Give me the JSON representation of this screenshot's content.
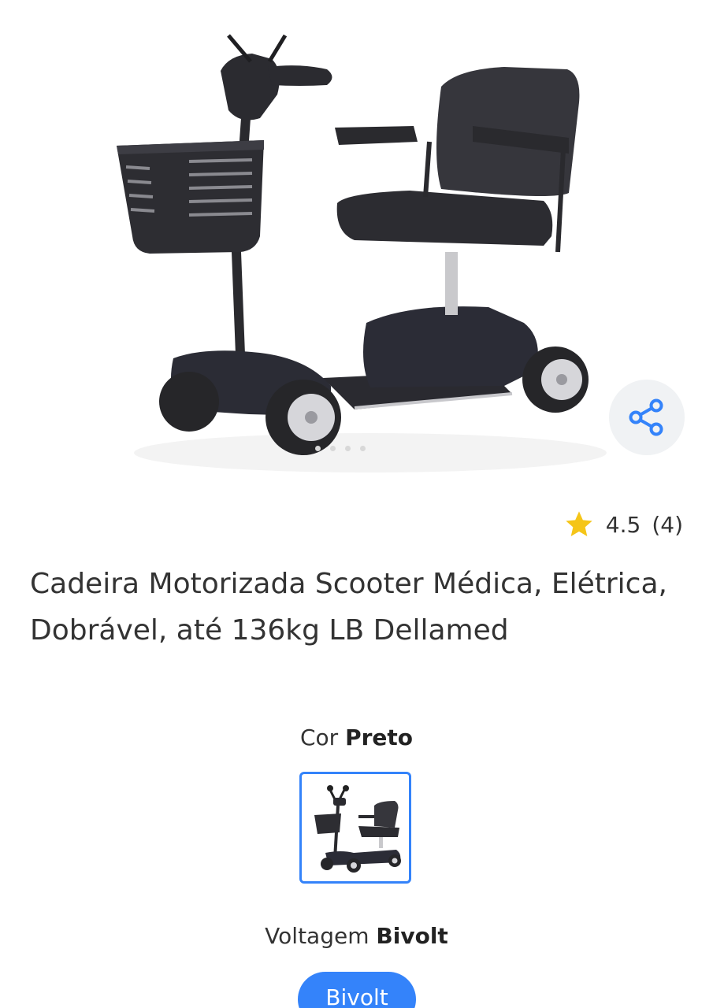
{
  "product": {
    "image_alt": "Scooter motorizada preta com cesto",
    "rating_value": "4.5",
    "rating_count": "(4)",
    "title": "Cadeira Motorizada Scooter Médica, Elétrica, Dobrável, até 136kg LB Dellamed"
  },
  "variants": {
    "color_label": "Cor",
    "color_value": "Preto",
    "voltage_label": "Voltagem",
    "voltage_value": "Bivolt",
    "voltage_option": "Bivolt"
  },
  "icons": {
    "share": "share-icon",
    "star": "star-icon"
  },
  "colors": {
    "accent": "#3483fa",
    "star": "#f5c518",
    "text": "#333333"
  }
}
